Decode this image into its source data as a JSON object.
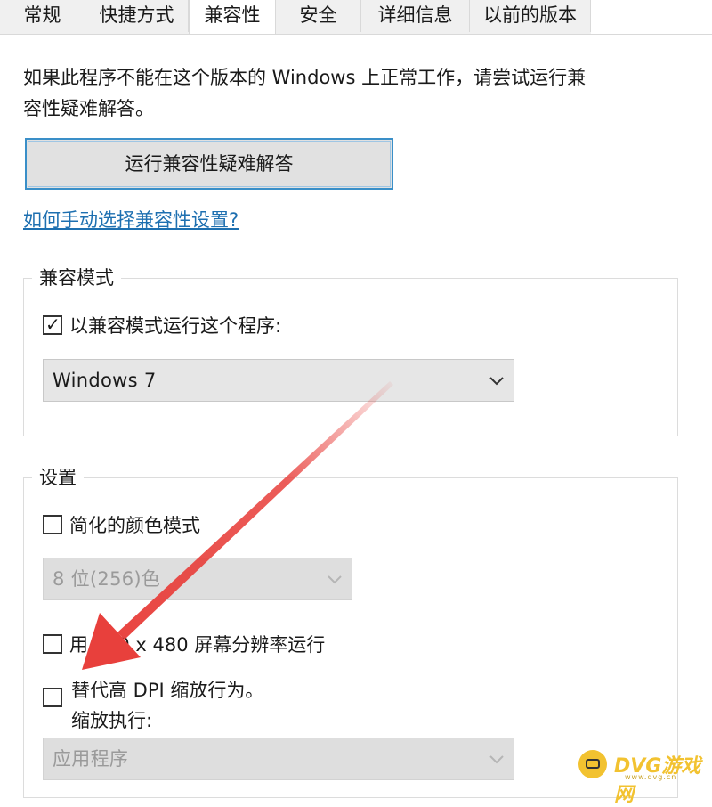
{
  "tabs": [
    {
      "label": "常规",
      "active": false
    },
    {
      "label": "快捷方式",
      "active": false
    },
    {
      "label": "兼容性",
      "active": true
    },
    {
      "label": "安全",
      "active": false
    },
    {
      "label": "详细信息",
      "active": false
    },
    {
      "label": "以前的版本",
      "active": false
    }
  ],
  "intro": {
    "line1": "如果此程序不能在这个版本的 Windows 上正常工作，请尝试运行兼",
    "line2": "容性疑难解答。"
  },
  "troubleshoot_button": "运行兼容性疑难解答",
  "manual_link": "如何手动选择兼容性设置?",
  "compat_mode": {
    "group_label": "兼容模式",
    "checkbox_label": "以兼容模式运行这个程序:",
    "checked": true,
    "selected_os": "Windows 7"
  },
  "settings": {
    "group_label": "设置",
    "reduced_color": {
      "label": "简化的颜色模式",
      "checked": false
    },
    "color_select": "8 位(256)色",
    "resolution": {
      "label": "用 640 x 480 屏幕分辨率运行",
      "checked": false
    },
    "dpi": {
      "label": "替代高 DPI 缩放行为。",
      "checked": false
    },
    "scaling_label": "缩放执行:",
    "scaling_select": "应用程序"
  },
  "watermark": {
    "text": "DVG游戏网",
    "sub": "www.dvg.cn"
  },
  "colors": {
    "arrow": "#e8403c",
    "link": "#1d6fb0",
    "focus_border": "#3a8fc8"
  },
  "icons": {
    "checkmark": "check-icon",
    "dropdown": "chevron-down-icon"
  }
}
